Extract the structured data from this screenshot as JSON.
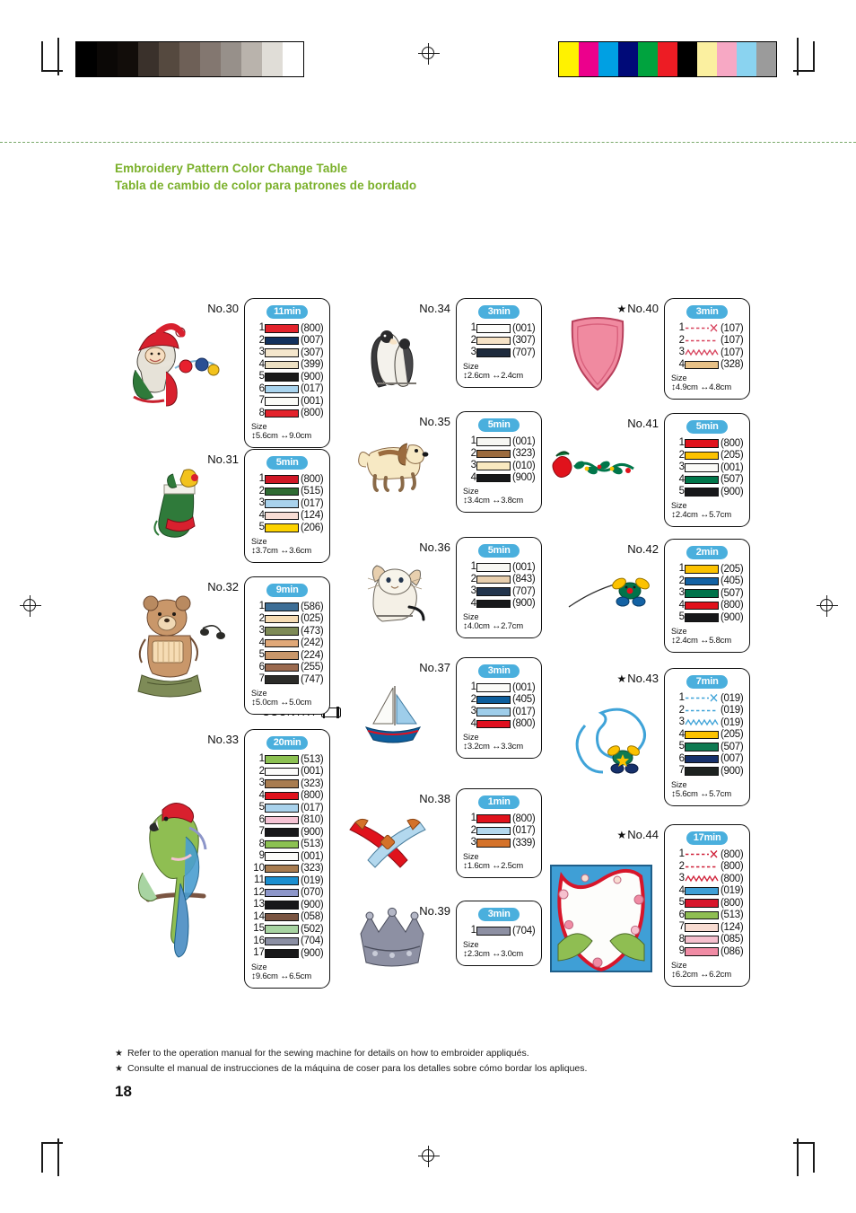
{
  "header": {
    "title_en": "Embroidery Pattern Color Change Table",
    "title_es": "Tabla de cambio de color para patrones de bordado",
    "accent": "#7ab02a"
  },
  "calibration": {
    "grayscale_bar": [
      "#000000",
      "#0b0806",
      "#120d0a",
      "#3a312b",
      "#55493f",
      "#6e6057",
      "#837770",
      "#97908a",
      "#b9b3ac",
      "#e0ddd7",
      "#ffffff"
    ],
    "color_bar": [
      "#fff200",
      "#ec008c",
      "#00a0e3",
      "#000a78",
      "#00a33e",
      "#ed1c24",
      "#000000",
      "#fbf0a0",
      "#f7a8c4",
      "#8ad3f0",
      "#9b9b9b"
    ]
  },
  "country_tag": {
    "label": "COUNTRY",
    "icon": "thread-spool-icon"
  },
  "size_label": "Size",
  "patterns": [
    {
      "id": "No.30",
      "starred": false,
      "time": "11min",
      "col": 0,
      "row": 0,
      "rows": [
        {
          "n": "1",
          "type": "swatch",
          "color": "#e3232c",
          "code": "(800)"
        },
        {
          "n": "2",
          "type": "swatch",
          "color": "#12315e",
          "code": "(007)"
        },
        {
          "n": "3",
          "type": "swatch",
          "color": "#f4e6cc",
          "code": "(307)"
        },
        {
          "n": "4",
          "type": "swatch",
          "color": "#ece0c3",
          "code": "(399)"
        },
        {
          "n": "5",
          "type": "swatch",
          "color": "#1a1a1a",
          "code": "(900)"
        },
        {
          "n": "6",
          "type": "swatch",
          "color": "#a9d4ee",
          "code": "(017)"
        },
        {
          "n": "7",
          "type": "swatch",
          "color": "#fbfbf7",
          "code": "(001)"
        },
        {
          "n": "8",
          "type": "swatch",
          "color": "#e3232c",
          "code": "(800)"
        }
      ],
      "height": "5.6cm",
      "width": "9.0cm"
    },
    {
      "id": "No.31",
      "starred": false,
      "time": "5min",
      "col": 0,
      "row": 1,
      "rows": [
        {
          "n": "1",
          "type": "swatch",
          "color": "#cf1626",
          "code": "(800)"
        },
        {
          "n": "2",
          "type": "swatch",
          "color": "#2f6b33",
          "code": "(515)"
        },
        {
          "n": "3",
          "type": "swatch",
          "color": "#a9d2ec",
          "code": "(017)"
        },
        {
          "n": "4",
          "type": "swatch",
          "color": "#f8ddd4",
          "code": "(124)"
        },
        {
          "n": "5",
          "type": "swatch",
          "color": "#fdd300",
          "code": "(206)"
        }
      ],
      "height": "3.7cm",
      "width": "3.6cm"
    },
    {
      "id": "No.32",
      "starred": false,
      "time": "9min",
      "col": 0,
      "row": 2,
      "rows": [
        {
          "n": "1",
          "type": "swatch",
          "color": "#3d6e96",
          "code": "(586)"
        },
        {
          "n": "2",
          "type": "swatch",
          "color": "#f6dcb4",
          "code": "(025)"
        },
        {
          "n": "3",
          "type": "swatch",
          "color": "#7e8b57",
          "code": "(473)"
        },
        {
          "n": "4",
          "type": "swatch",
          "color": "#e0a878",
          "code": "(242)"
        },
        {
          "n": "5",
          "type": "swatch",
          "color": "#c9976a",
          "code": "(224)"
        },
        {
          "n": "6",
          "type": "swatch",
          "color": "#9b6a4f",
          "code": "(255)"
        },
        {
          "n": "7",
          "type": "swatch",
          "color": "#2b2b28",
          "code": "(747)"
        }
      ],
      "height": "5.0cm",
      "width": "5.0cm"
    },
    {
      "id": "No.33",
      "starred": false,
      "time": "20min",
      "col": 0,
      "row": 3,
      "rows": [
        {
          "n": "1",
          "type": "swatch",
          "color": "#8cc152",
          "code": "(513)"
        },
        {
          "n": "2",
          "type": "swatch",
          "color": "#fcfcfa",
          "code": "(001)"
        },
        {
          "n": "3",
          "type": "swatch",
          "color": "#a87c50",
          "code": "(323)"
        },
        {
          "n": "4",
          "type": "swatch",
          "color": "#e0121c",
          "code": "(800)"
        },
        {
          "n": "5",
          "type": "swatch",
          "color": "#a9d2ec",
          "code": "(017)"
        },
        {
          "n": "6",
          "type": "swatch",
          "color": "#f5c3d4",
          "code": "(810)"
        },
        {
          "n": "7",
          "type": "swatch",
          "color": "#18181a",
          "code": "(900)"
        },
        {
          "n": "8",
          "type": "swatch",
          "color": "#8cc152",
          "code": "(513)"
        },
        {
          "n": "9",
          "type": "swatch",
          "color": "#fcfcfa",
          "code": "(001)"
        },
        {
          "n": "10",
          "type": "swatch",
          "color": "#a87c50",
          "code": "(323)"
        },
        {
          "n": "11",
          "type": "swatch",
          "color": "#1b8fd0",
          "code": "(019)"
        },
        {
          "n": "12",
          "type": "swatch",
          "color": "#8d96c9",
          "code": "(070)"
        },
        {
          "n": "13",
          "type": "swatch",
          "color": "#18181a",
          "code": "(900)"
        },
        {
          "n": "14",
          "type": "swatch",
          "color": "#7a5542",
          "code": "(058)"
        },
        {
          "n": "15",
          "type": "swatch",
          "color": "#a8d4a2",
          "code": "(502)"
        },
        {
          "n": "16",
          "type": "swatch",
          "color": "#8b8fa3",
          "code": "(704)"
        },
        {
          "n": "17",
          "type": "swatch",
          "color": "#18181a",
          "code": "(900)"
        }
      ],
      "height": "9.6cm",
      "width": "6.5cm"
    },
    {
      "id": "No.34",
      "starred": false,
      "time": "3min",
      "col": 1,
      "row": 0,
      "rows": [
        {
          "n": "1",
          "type": "swatch",
          "color": "#fdfdfb",
          "code": "(001)"
        },
        {
          "n": "2",
          "type": "swatch",
          "color": "#f7e3c6",
          "code": "(307)"
        },
        {
          "n": "3",
          "type": "swatch",
          "color": "#1e2b3d",
          "code": "(707)"
        }
      ],
      "height": "2.6cm",
      "width": "2.4cm"
    },
    {
      "id": "No.35",
      "starred": false,
      "time": "5min",
      "col": 1,
      "row": 1,
      "rows": [
        {
          "n": "1",
          "type": "swatch",
          "color": "#f7f7f3",
          "code": "(001)"
        },
        {
          "n": "2",
          "type": "swatch",
          "color": "#9b6b3e",
          "code": "(323)"
        },
        {
          "n": "3",
          "type": "swatch",
          "color": "#f9e9c0",
          "code": "(010)"
        },
        {
          "n": "4",
          "type": "swatch",
          "color": "#17181a",
          "code": "(900)"
        }
      ],
      "height": "3.4cm",
      "width": "3.8cm"
    },
    {
      "id": "No.36",
      "starred": false,
      "time": "5min",
      "col": 1,
      "row": 2,
      "rows": [
        {
          "n": "1",
          "type": "swatch",
          "color": "#f7f7f3",
          "code": "(001)"
        },
        {
          "n": "2",
          "type": "swatch",
          "color": "#e8cfae",
          "code": "(843)"
        },
        {
          "n": "3",
          "type": "swatch",
          "color": "#22344c",
          "code": "(707)"
        },
        {
          "n": "4",
          "type": "swatch",
          "color": "#17181a",
          "code": "(900)"
        }
      ],
      "height": "4.0cm",
      "width": "2.7cm"
    },
    {
      "id": "No.37",
      "starred": false,
      "time": "3min",
      "col": 1,
      "row": 3,
      "rows": [
        {
          "n": "1",
          "type": "swatch",
          "color": "#fbfbf8",
          "code": "(001)"
        },
        {
          "n": "2",
          "type": "swatch",
          "color": "#0d5e9c",
          "code": "(405)"
        },
        {
          "n": "3",
          "type": "swatch",
          "color": "#9ecdea",
          "code": "(017)"
        },
        {
          "n": "4",
          "type": "swatch",
          "color": "#e01020",
          "code": "(800)"
        }
      ],
      "height": "3.2cm",
      "width": "3.3cm"
    },
    {
      "id": "No.38",
      "starred": false,
      "time": "1min",
      "col": 1,
      "row": 4,
      "rows": [
        {
          "n": "1",
          "type": "swatch",
          "color": "#e0121c",
          "code": "(800)"
        },
        {
          "n": "2",
          "type": "swatch",
          "color": "#b3d8ee",
          "code": "(017)"
        },
        {
          "n": "3",
          "type": "swatch",
          "color": "#d4722a",
          "code": "(339)"
        }
      ],
      "height": "1.6cm",
      "width": "2.5cm"
    },
    {
      "id": "No.39",
      "starred": false,
      "time": "3min",
      "col": 1,
      "row": 5,
      "rows": [
        {
          "n": "1",
          "type": "swatch",
          "color": "#8d90a3",
          "code": "(704)"
        }
      ],
      "height": "2.3cm",
      "width": "3.0cm"
    },
    {
      "id": "No.40",
      "starred": true,
      "time": "3min",
      "col": 2,
      "row": 0,
      "rows": [
        {
          "n": "1",
          "type": "dashed-cut",
          "color": "#d8455f",
          "code": "(107)"
        },
        {
          "n": "2",
          "type": "dashed",
          "color": "#d8455f",
          "code": "(107)"
        },
        {
          "n": "3",
          "type": "zigzag",
          "color": "#d8455f",
          "code": "(107)"
        },
        {
          "n": "4",
          "type": "swatch",
          "color": "#e8c187",
          "code": "(328)"
        }
      ],
      "height": "4.9cm",
      "width": "4.8cm"
    },
    {
      "id": "No.41",
      "starred": false,
      "time": "5min",
      "col": 2,
      "row": 1,
      "rows": [
        {
          "n": "1",
          "type": "swatch",
          "color": "#e0121c",
          "code": "(800)"
        },
        {
          "n": "2",
          "type": "swatch",
          "color": "#fcc200",
          "code": "(205)"
        },
        {
          "n": "3",
          "type": "swatch",
          "color": "#fbfbf8",
          "code": "(001)"
        },
        {
          "n": "4",
          "type": "swatch",
          "color": "#00764a",
          "code": "(507)"
        },
        {
          "n": "5",
          "type": "swatch",
          "color": "#17181a",
          "code": "(900)"
        }
      ],
      "height": "2.4cm",
      "width": "5.7cm"
    },
    {
      "id": "No.42",
      "starred": false,
      "time": "2min",
      "col": 2,
      "row": 2,
      "rows": [
        {
          "n": "1",
          "type": "swatch",
          "color": "#fcc200",
          "code": "(205)"
        },
        {
          "n": "2",
          "type": "swatch",
          "color": "#1362a4",
          "code": "(405)"
        },
        {
          "n": "3",
          "type": "swatch",
          "color": "#00734a",
          "code": "(507)"
        },
        {
          "n": "4",
          "type": "swatch",
          "color": "#e0121c",
          "code": "(800)"
        },
        {
          "n": "5",
          "type": "swatch",
          "color": "#17181a",
          "code": "(900)"
        }
      ],
      "height": "2.4cm",
      "width": "5.8cm"
    },
    {
      "id": "No.43",
      "starred": true,
      "time": "7min",
      "col": 2,
      "row": 3,
      "rows": [
        {
          "n": "1",
          "type": "dashed-cut",
          "color": "#3fa3d8",
          "code": "(019)"
        },
        {
          "n": "2",
          "type": "dashed",
          "color": "#3fa3d8",
          "code": "(019)"
        },
        {
          "n": "3",
          "type": "zigzag",
          "color": "#3fa3d8",
          "code": "(019)"
        },
        {
          "n": "4",
          "type": "swatch",
          "color": "#fcc200",
          "code": "(205)"
        },
        {
          "n": "5",
          "type": "swatch",
          "color": "#0f7a52",
          "code": "(507)"
        },
        {
          "n": "6",
          "type": "swatch",
          "color": "#16306b",
          "code": "(007)"
        },
        {
          "n": "7",
          "type": "swatch",
          "color": "#1d2220",
          "code": "(900)"
        }
      ],
      "height": "5.6cm",
      "width": "5.7cm"
    },
    {
      "id": "No.44",
      "starred": true,
      "time": "17min",
      "col": 2,
      "row": 4,
      "rows": [
        {
          "n": "1",
          "type": "dashed-cut",
          "color": "#cf2038",
          "code": "(800)"
        },
        {
          "n": "2",
          "type": "dashed",
          "color": "#cf2038",
          "code": "(800)"
        },
        {
          "n": "3",
          "type": "zigzag",
          "color": "#cf2038",
          "code": "(800)"
        },
        {
          "n": "4",
          "type": "swatch",
          "color": "#3f9fd6",
          "code": "(019)"
        },
        {
          "n": "5",
          "type": "swatch",
          "color": "#d7162b",
          "code": "(800)"
        },
        {
          "n": "6",
          "type": "swatch",
          "color": "#8fbe52",
          "code": "(513)"
        },
        {
          "n": "7",
          "type": "swatch",
          "color": "#f8dcd2",
          "code": "(124)"
        },
        {
          "n": "8",
          "type": "swatch",
          "color": "#f6c0ce",
          "code": "(085)"
        },
        {
          "n": "9",
          "type": "swatch",
          "color": "#f08ba4",
          "code": "(086)"
        }
      ],
      "height": "6.2cm",
      "width": "6.2cm"
    }
  ],
  "notes": [
    "Refer to the operation manual for the sewing machine for details on how to embroider appliqués.",
    "Consulte el manual de instrucciones de la máquina de coser para los detalles sobre cómo bordar los apliques."
  ],
  "page_number": "18"
}
